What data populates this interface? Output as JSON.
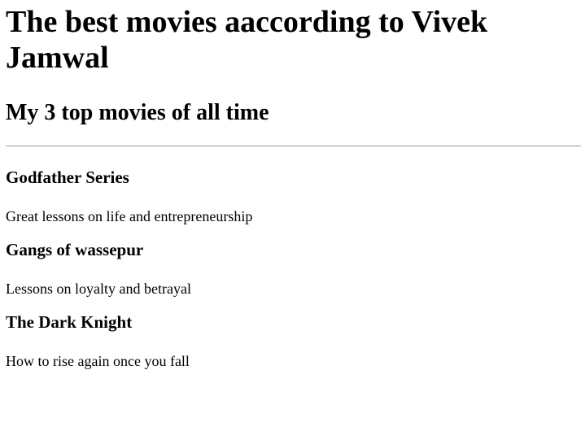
{
  "header": {
    "title": "The best movies aaccording to Vivek Jamwal",
    "subtitle": "My 3 top movies of all time"
  },
  "movies": [
    {
      "title": "Godfather Series",
      "description": "Great lessons on life and entrepreneurship"
    },
    {
      "title": "Gangs of wassepur",
      "description": "Lessons on loyalty and betrayal"
    },
    {
      "title": "The Dark Knight",
      "description": "How to rise again once you fall"
    }
  ]
}
